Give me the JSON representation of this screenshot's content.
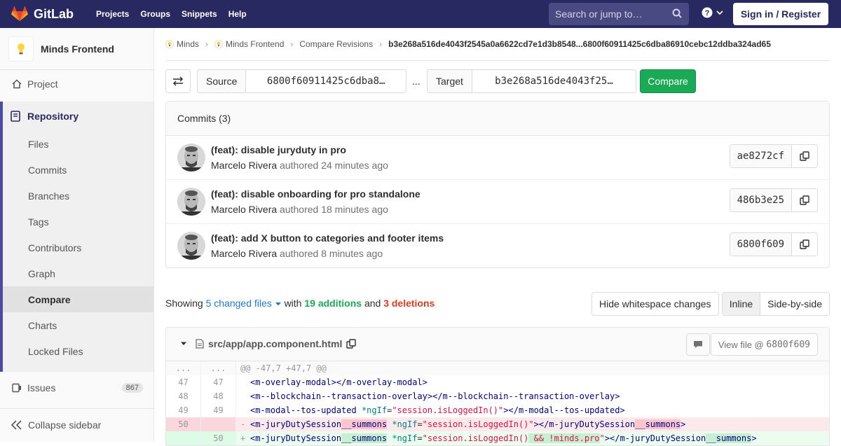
{
  "navbar": {
    "brand": "GitLab",
    "links": [
      "Projects",
      "Groups",
      "Snippets",
      "Help"
    ],
    "search_placeholder": "Search or jump to…",
    "signin": "Sign in / Register"
  },
  "sidebar": {
    "project_name": "Minds Frontend",
    "project": "Project",
    "repository": "Repository",
    "repo_items": [
      "Files",
      "Commits",
      "Branches",
      "Tags",
      "Contributors",
      "Graph",
      "Compare",
      "Charts",
      "Locked Files"
    ],
    "active_item": "Compare",
    "issues": "Issues",
    "issues_count": "867",
    "collapse": "Collapse sidebar"
  },
  "breadcrumbs": [
    "Minds",
    "Minds Frontend",
    "Compare Revisions",
    "b3e268a516de4043f2545a0a6622cd7e1d3b8548...6800f60911425c6dba86910cebc12ddba324ad65"
  ],
  "compare": {
    "source_label": "Source",
    "source_value": "6800f60911425c6dba8…",
    "dots": "...",
    "target_label": "Target",
    "target_value": "b3e268a516de4043f25…",
    "button": "Compare"
  },
  "commits": {
    "header": "Commits (3)",
    "items": [
      {
        "title": "(feat): disable juryduty in pro",
        "author": "Marcelo Rivera",
        "meta": "authored 24 minutes ago",
        "sha": "ae8272cf"
      },
      {
        "title": "(feat): disable onboarding for pro standalone",
        "author": "Marcelo Rivera",
        "meta": "authored 18 minutes ago",
        "sha": "486b3e25"
      },
      {
        "title": "(feat): add X button to categories and footer items",
        "author": "Marcelo Rivera",
        "meta": "authored 8 minutes ago",
        "sha": "6800f609"
      }
    ]
  },
  "summary": {
    "showing": "Showing",
    "changed": "5 changed files",
    "with": "with",
    "additions": "19 additions",
    "and": "and",
    "deletions": "3 deletions",
    "hide_ws": "Hide whitespace changes",
    "inline": "Inline",
    "side_by_side": "Side-by-side"
  },
  "file": {
    "path": "src/app/app.component.html",
    "view_file": "View file @ ",
    "view_sha": "6800f609"
  },
  "diff": {
    "hunk_old": "...",
    "hunk_new": "...",
    "hunk": "@@ -47,7 +47,7 @@",
    "lines": [
      {
        "o": "47",
        "n": "47",
        "text": "<m-overlay-modal></m-overlay-modal>"
      },
      {
        "o": "48",
        "n": "48",
        "text": "<m--blockchain--transaction-overlay></m--blockchain--transaction-overlay>"
      },
      {
        "o": "49",
        "n": "49",
        "text": "<m-modal--tos-updated *ngIf=\"session.isLoggedIn()\"></m-modal--tos-updated>"
      }
    ],
    "old_line_no": "50",
    "new_line_no": "50",
    "old_sign": "-",
    "new_sign": "+"
  }
}
